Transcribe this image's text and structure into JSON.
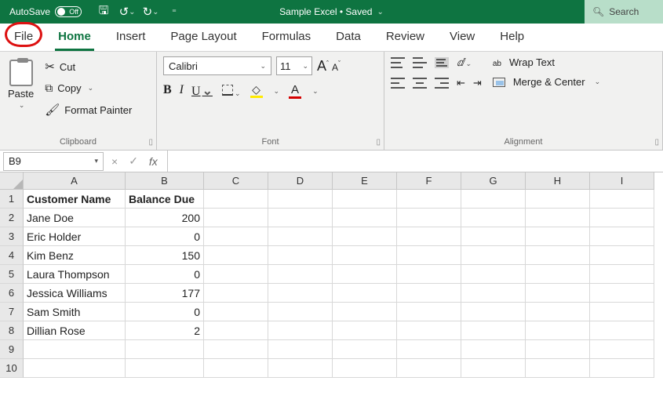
{
  "title": {
    "autosave": "AutoSave",
    "autosave_state": "Off",
    "doc": "Sample Excel • Saved",
    "search_placeholder": "Search"
  },
  "tabs": [
    "File",
    "Home",
    "Insert",
    "Page Layout",
    "Formulas",
    "Data",
    "Review",
    "View",
    "Help"
  ],
  "active_tab": "Home",
  "ribbon": {
    "clipboard": {
      "paste": "Paste",
      "cut": "Cut",
      "copy": "Copy",
      "painter": "Format Painter",
      "label": "Clipboard"
    },
    "font": {
      "name": "Calibri",
      "size": "11",
      "label": "Font"
    },
    "align": {
      "wrap": "Wrap Text",
      "merge": "Merge & Center",
      "label": "Alignment"
    }
  },
  "fbar": {
    "cellref": "B9",
    "formula": ""
  },
  "columns": [
    "A",
    "B",
    "C",
    "D",
    "E",
    "F",
    "G",
    "H",
    "I"
  ],
  "row_count": 10,
  "headers": {
    "A": "Customer Name",
    "B": "Balance Due"
  },
  "rows": [
    {
      "A": "Jane Doe",
      "B": "200"
    },
    {
      "A": "Eric Holder",
      "B": "0"
    },
    {
      "A": "Kim Benz",
      "B": "150"
    },
    {
      "A": "Laura Thompson",
      "B": "0"
    },
    {
      "A": "Jessica Williams",
      "B": "177"
    },
    {
      "A": "Sam Smith",
      "B": "0"
    },
    {
      "A": "Dillian Rose",
      "B": "2"
    }
  ]
}
